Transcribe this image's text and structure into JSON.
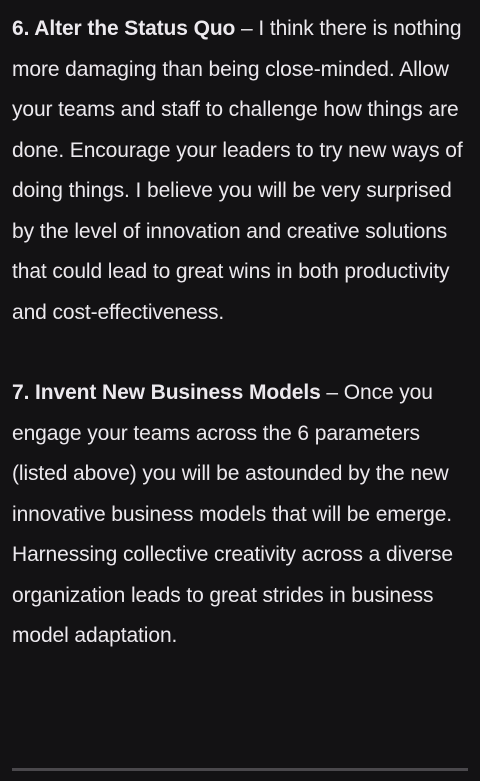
{
  "article": {
    "paragraphs": [
      {
        "heading": "6. Alter the Status Quo",
        "separator": " – ",
        "body": "I think there is nothing more damaging than being close-minded. Allow your teams and staff to challenge how things are done. Encourage your leaders to try new ways of doing things. I believe you will be very surprised by the level of innovation and creative solutions that could lead to great wins in both productivity and cost-effectiveness."
      },
      {
        "heading": "7. Invent New Business Models",
        "separator": " – ",
        "body": "Once you engage your teams across the 6 parameters (listed above) you will be astounded by the new innovative business models that will be emerge. Harnessing collective creativity across a diverse organization leads to great strides in business model adaptation."
      }
    ]
  }
}
